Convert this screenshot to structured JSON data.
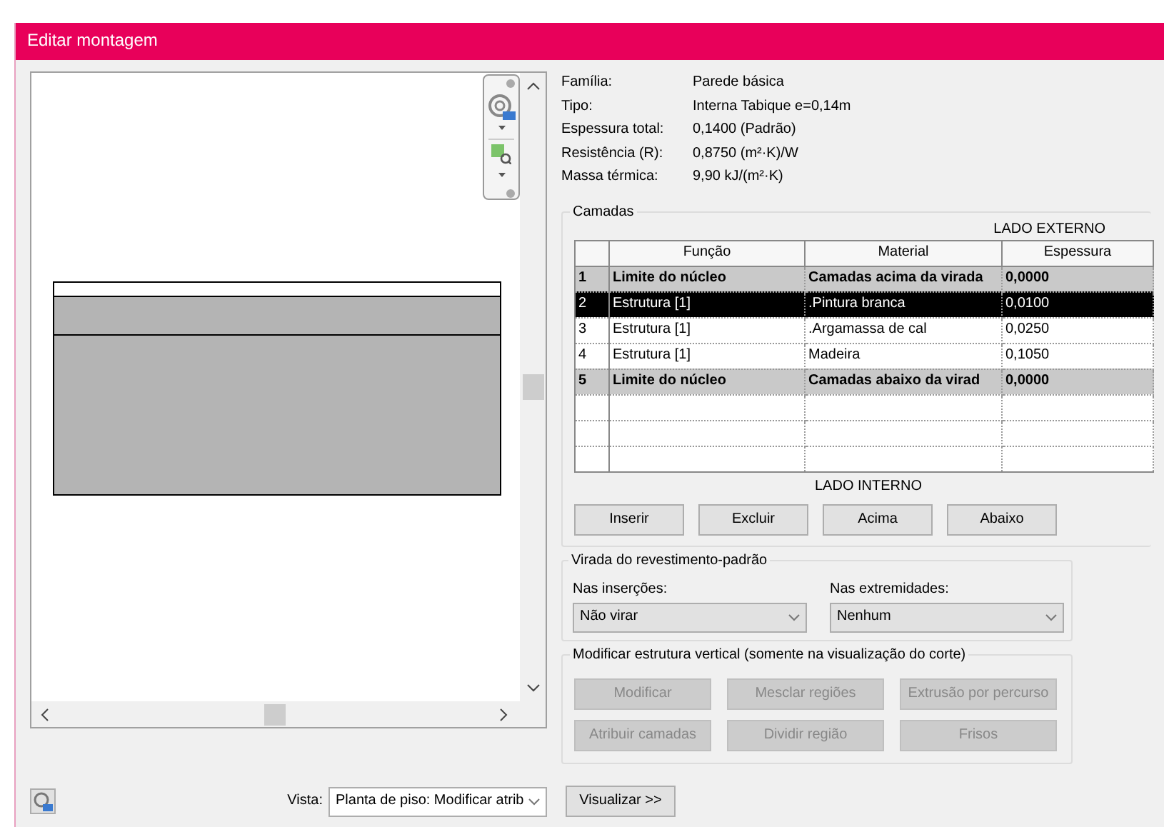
{
  "window": {
    "title": "Editar montagem"
  },
  "properties": [
    {
      "label": "Família:",
      "value": "Parede básica"
    },
    {
      "label": "Tipo:",
      "value": "Interna Tabique e=0,14m"
    },
    {
      "label": "Espessura total:",
      "value": "0,1400 (Padrão)"
    },
    {
      "label": "Resistência (R):",
      "value": "0,8750 (m²·K)/W"
    },
    {
      "label": "Massa térmica:",
      "value": "9,90 kJ/(m²·K)"
    }
  ],
  "layers": {
    "title": "Camadas",
    "exterior_label": "LADO EXTERNO",
    "interior_label": "LADO INTERNO",
    "columns": [
      "Função",
      "Material",
      "Espessura"
    ],
    "rows": [
      {
        "number": "1",
        "function": "Limite do núcleo",
        "material": "Camadas acima da virada",
        "thickness": "0,0000",
        "kind": "boundary",
        "selected": false
      },
      {
        "number": "2",
        "function": "Estrutura [1]",
        "material": ".Pintura branca",
        "thickness": "0,0100",
        "kind": "layer",
        "selected": true
      },
      {
        "number": "3",
        "function": "Estrutura [1]",
        "material": ".Argamassa de cal",
        "thickness": "0,0250",
        "kind": "layer",
        "selected": false
      },
      {
        "number": "4",
        "function": "Estrutura [1]",
        "material": "Madeira",
        "thickness": "0,1050",
        "kind": "layer",
        "selected": false
      },
      {
        "number": "5",
        "function": "Limite do núcleo",
        "material": "Camadas abaixo da virad",
        "thickness": "0,0000",
        "kind": "boundary",
        "selected": false
      }
    ],
    "buttons": [
      "Inserir",
      "Excluir",
      "Acima",
      "Abaixo"
    ]
  },
  "wrapping": {
    "title": "Virada do revestimento-padrão",
    "fields": [
      {
        "label": "Nas inserções:",
        "value": "Não virar"
      },
      {
        "label": "Nas extremidades:",
        "value": "Nenhum"
      }
    ]
  },
  "vertical_structure": {
    "title": "Modificar estrutura vertical (somente na visualização do corte)",
    "buttons": [
      {
        "label": "Modificar",
        "disabled": true
      },
      {
        "label": "Mesclar regiões",
        "disabled": true
      },
      {
        "label": "Extrusão por percurso",
        "disabled": true
      },
      {
        "label": "Atribuir camadas",
        "disabled": true
      },
      {
        "label": "Dividir região",
        "disabled": true
      },
      {
        "label": "Frisos",
        "disabled": true
      }
    ]
  },
  "view": {
    "label": "Vista:",
    "value": "Planta de piso: Modificar atrib"
  },
  "preview_button": "Visualizar >>"
}
